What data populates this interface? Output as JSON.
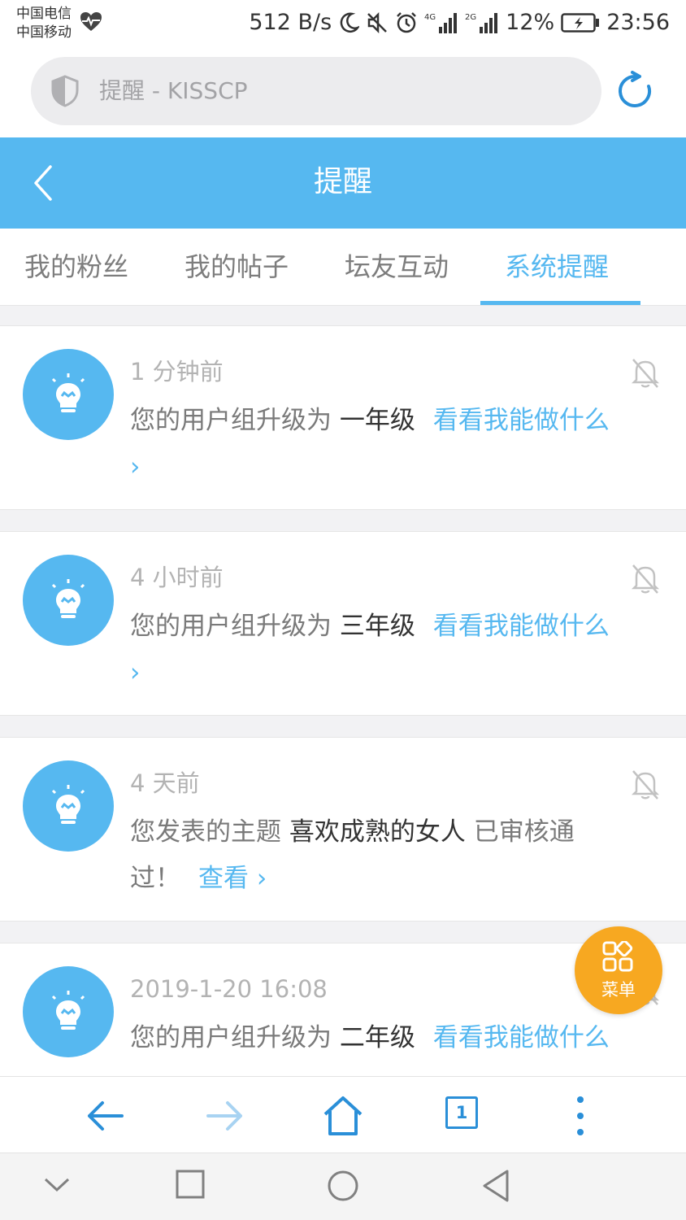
{
  "status_bar": {
    "carrier1": "中国电信",
    "carrier2": "中国移动",
    "net_speed": "512 B/s",
    "battery": "12%",
    "time": "23:56",
    "sig1_label": "4G",
    "sig2_label": "2G"
  },
  "browser": {
    "address_text": "提醒 - KISSCP"
  },
  "header": {
    "title": "提醒"
  },
  "tabs": [
    {
      "label": "我的粉丝"
    },
    {
      "label": "我的帖子"
    },
    {
      "label": "坛友互动"
    },
    {
      "label": "系统提醒"
    }
  ],
  "notifications": [
    {
      "time": "1 分钟前",
      "prefix": "您的用户组升级为 ",
      "highlight": "一年级",
      "middle": "",
      "link": "看看我能做什么 ›"
    },
    {
      "time": "4 小时前",
      "prefix": "您的用户组升级为 ",
      "highlight": "三年级",
      "middle": "",
      "link": "看看我能做什么 ›"
    },
    {
      "time": "4 天前",
      "prefix": "您发表的主题 ",
      "highlight": "喜欢成熟的女人",
      "middle": " 已审核通过！",
      "link": "查看 ›"
    },
    {
      "time": "2019-1-20 16:08",
      "prefix": "您的用户组升级为 ",
      "highlight": "二年级",
      "middle": "",
      "link": "看看我能做什么 ›"
    }
  ],
  "fab": {
    "label": "菜单"
  },
  "toolbar": {
    "tab_count": "1"
  },
  "colors": {
    "accent": "#56b8f0",
    "fab": "#f7a821",
    "toolbar_icon": "#2a8fd8"
  },
  "icons": [
    "shield-icon",
    "reload-icon",
    "back-chevron-icon",
    "lightbulb-icon",
    "bell-off-icon",
    "grid-menu-icon",
    "arrow-left-icon",
    "arrow-right-icon",
    "home-icon",
    "more-vertical-icon",
    "nav-down-icon",
    "nav-square-icon",
    "nav-circle-icon",
    "nav-triangle-icon"
  ]
}
